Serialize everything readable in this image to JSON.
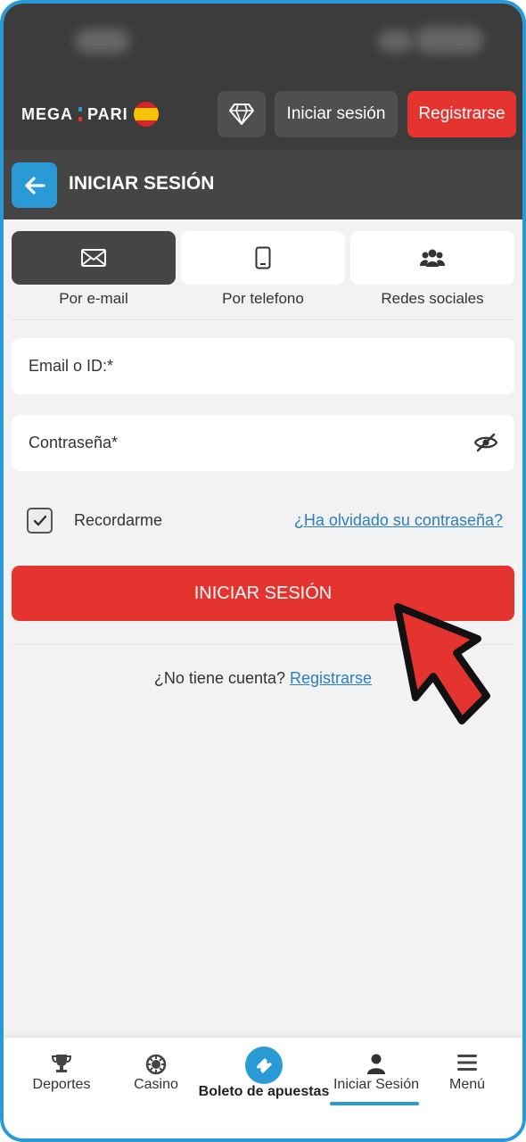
{
  "colors": {
    "accent": "#2a9ad6",
    "danger": "#e5342f",
    "header": "#3c3c3c",
    "background": "#f2f2f2"
  },
  "header": {
    "logo_left": "MEGA",
    "logo_right": "PARI",
    "login_label": "Iniciar sesión",
    "register_label": "Registrarse",
    "diamond_icon": "diamond-icon"
  },
  "title_bar": {
    "title": "INICIAR SESIÓN",
    "back_icon": "arrow-left-icon"
  },
  "tabs": [
    {
      "label": "Por e-mail",
      "icon": "envelope-icon",
      "active": true
    },
    {
      "label": "Por telefono",
      "icon": "phone-icon",
      "active": false
    },
    {
      "label": "Redes sociales",
      "icon": "users-icon",
      "active": false
    }
  ],
  "form": {
    "email_placeholder": "Email o ID:*",
    "password_placeholder": "Contraseña*",
    "remember_label": "Recordarme",
    "remember_checked": true,
    "forgot_label": "¿Ha olvidado su contraseña?",
    "submit_label": "INICIAR SESIÓN"
  },
  "no_account": {
    "text": "¿No tiene cuenta?",
    "link": "Registrarse"
  },
  "bottom_nav": [
    {
      "label": "Deportes",
      "icon": "trophy-icon"
    },
    {
      "label": "Casino",
      "icon": "casino-chip-icon"
    },
    {
      "label": "Boleto de apuestas",
      "icon": "ticket-icon"
    },
    {
      "label": "Iniciar Sesión",
      "icon": "user-icon",
      "active": true
    },
    {
      "label": "Menú",
      "icon": "hamburger-menu-icon"
    }
  ]
}
